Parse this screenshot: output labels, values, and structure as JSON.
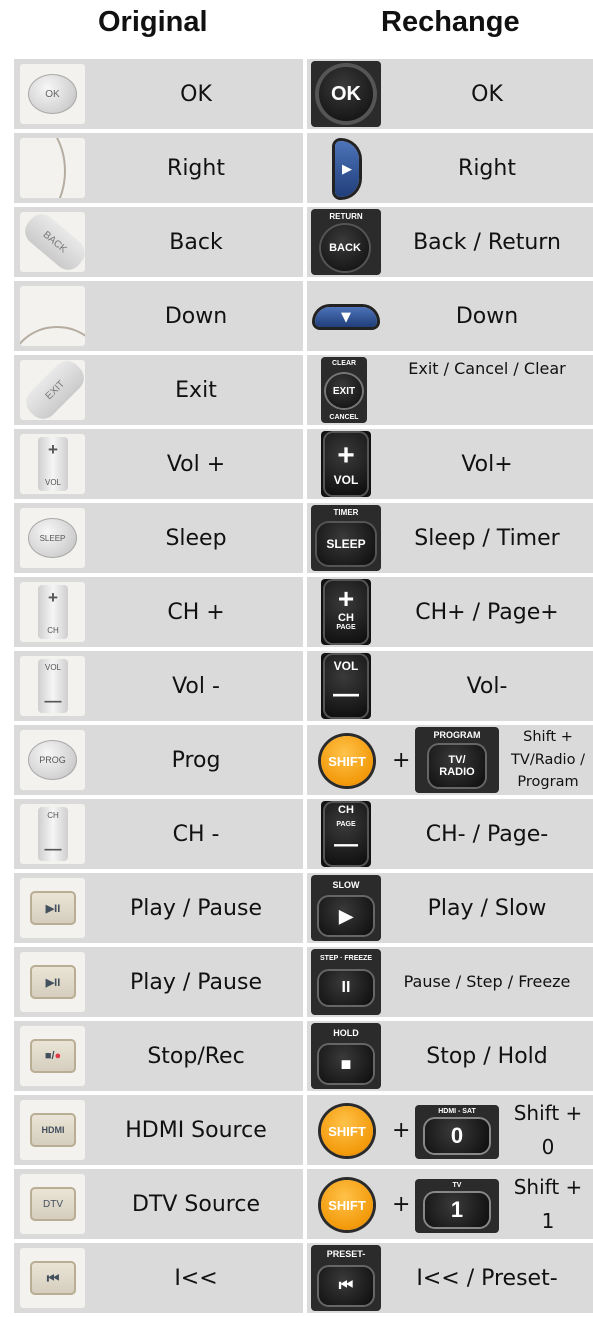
{
  "headers": {
    "original": "Original",
    "rechange": "Rechange"
  },
  "rows": [
    {
      "orig": {
        "label": "OK",
        "key_text": "OK"
      },
      "new": {
        "label": "OK",
        "key_text": "OK"
      }
    },
    {
      "orig": {
        "label": "Right"
      },
      "new": {
        "label": "Right",
        "key_text": "▶"
      }
    },
    {
      "orig": {
        "label": "Back",
        "key_text": "BACK"
      },
      "new": {
        "label": "Back / Return",
        "key_text": "BACK",
        "top_text": "RETURN"
      }
    },
    {
      "orig": {
        "label": "Down"
      },
      "new": {
        "label": "Down",
        "key_text": "▼"
      }
    },
    {
      "orig": {
        "label": "Exit",
        "key_text": "EXIT"
      },
      "new": {
        "label": "Exit / Cancel / Clear",
        "key_text": "EXIT",
        "top_text": "CLEAR",
        "bottom_text": "CANCEL"
      }
    },
    {
      "orig": {
        "label": "Vol +",
        "key_text": "+",
        "sub_text": "VOL"
      },
      "new": {
        "label": "Vol+",
        "key_text": "+",
        "sub_text": "VOL"
      }
    },
    {
      "orig": {
        "label": "Sleep",
        "key_text": "SLEEP"
      },
      "new": {
        "label": "Sleep / Timer",
        "key_text": "SLEEP",
        "top_text": "TIMER"
      }
    },
    {
      "orig": {
        "label": "CH +",
        "key_text": "+",
        "sub_text": "CH"
      },
      "new": {
        "label": "CH+ / Page+",
        "key_text": "+",
        "sub_text": "CH",
        "sub_text2": "PAGE"
      }
    },
    {
      "orig": {
        "label": "Vol -",
        "key_text": "—",
        "sub_text": "VOL"
      },
      "new": {
        "label": "Vol-",
        "key_text": "—",
        "sub_text": "VOL"
      }
    },
    {
      "orig": {
        "label": "Prog",
        "key_text": "PROG"
      },
      "new": {
        "label": "Shift + TV/Radio / Program",
        "key_text": "SHIFT",
        "plus": "+",
        "second_key": "TV/\nRADIO",
        "top_text": "PROGRAM"
      }
    },
    {
      "orig": {
        "label": "CH -",
        "key_text": "—",
        "sub_text": "CH"
      },
      "new": {
        "label": "CH- / Page-",
        "key_text": "—",
        "sub_text": "CH",
        "sub_text2": "PAGE"
      }
    },
    {
      "orig": {
        "label": "Play / Pause",
        "key_text": "▶II"
      },
      "new": {
        "label": "Play / Slow",
        "key_text": "▶",
        "top_text": "SLOW"
      }
    },
    {
      "orig": {
        "label": "Play / Pause",
        "key_text": "▶II"
      },
      "new": {
        "label": "Pause / Step / Freeze",
        "key_text": "II",
        "top_text": "STEP · FREEZE"
      }
    },
    {
      "orig": {
        "label": "Stop/Rec",
        "key_text": "■/",
        "key_text2": "●"
      },
      "new": {
        "label": "Stop / Hold",
        "key_text": "■",
        "top_text": "HOLD"
      }
    },
    {
      "orig": {
        "label": "HDMI Source",
        "key_text": "HDMI"
      },
      "new": {
        "label": "Shift + 0",
        "key_text": "SHIFT",
        "plus": "+",
        "second_key": "0",
        "top_text": "HDMI - SAT"
      }
    },
    {
      "orig": {
        "label": "DTV Source",
        "key_text": "DTV"
      },
      "new": {
        "label": "Shift + 1",
        "key_text": "SHIFT",
        "plus": "+",
        "second_key": "1",
        "top_text": "TV"
      }
    },
    {
      "orig": {
        "label": "I<<",
        "key_text": "⏮"
      },
      "new": {
        "label": "I<< / Preset-",
        "key_text": "⏮",
        "top_text": "PRESET-"
      }
    }
  ]
}
